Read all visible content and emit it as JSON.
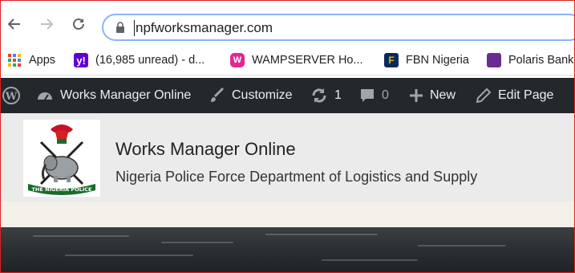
{
  "browser": {
    "url": "npfworksmanager.com",
    "bookmarks": [
      {
        "label": "Apps",
        "icon": "apps-grid-icon"
      },
      {
        "label": "(16,985 unread) - d...",
        "icon": "yahoo-icon"
      },
      {
        "label": "WAMPSERVER Ho...",
        "icon": "wampserver-icon"
      },
      {
        "label": "FBN Nigeria",
        "icon": "fbn-icon"
      },
      {
        "label": "Polaris Bank",
        "icon": "polaris-icon"
      }
    ]
  },
  "adminbar": {
    "site_name": "Works Manager Online",
    "customize": "Customize",
    "updates_count": "1",
    "comments_count": "0",
    "new": "New",
    "edit_page": "Edit Page"
  },
  "site": {
    "title": "Works Manager Online",
    "description": "Nigeria Police Force Department of Logistics and Supply"
  },
  "colors": {
    "adminbar_bg": "#23282d",
    "header_bg": "#ebebeb",
    "omnibox_focus": "#8ab4f8"
  }
}
